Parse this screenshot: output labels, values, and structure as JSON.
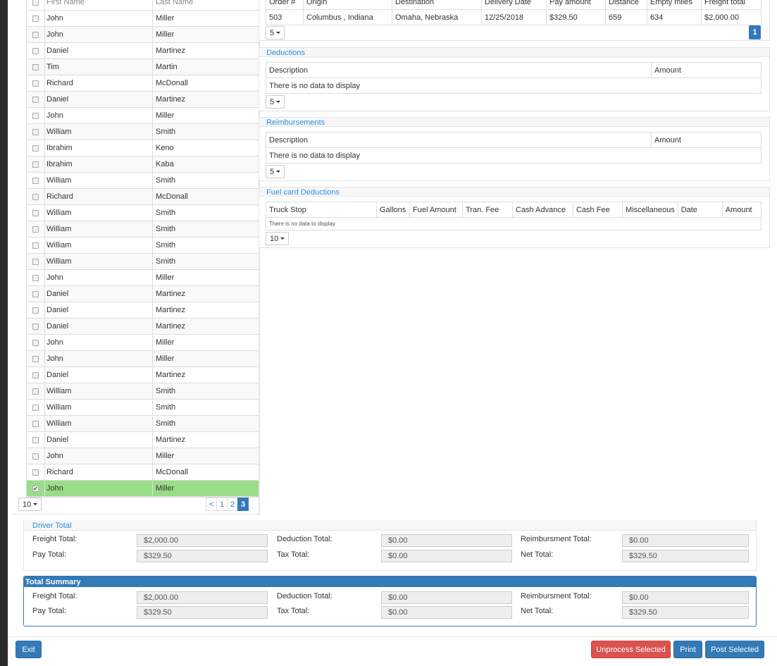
{
  "drivers": {
    "columns": [
      "First Name",
      "Last Name"
    ],
    "rows": [
      [
        "John",
        "Miller"
      ],
      [
        "John",
        "Miller"
      ],
      [
        "Daniel",
        "Martinez"
      ],
      [
        "Tim",
        "Martin"
      ],
      [
        "Richard",
        "McDonall"
      ],
      [
        "Daniel",
        "Martinez"
      ],
      [
        "John",
        "Miller"
      ],
      [
        "William",
        "Smith"
      ],
      [
        "Ibrahim",
        "Keno"
      ],
      [
        "Ibrahim",
        "Kaba"
      ],
      [
        "William",
        "Smith"
      ],
      [
        "Richard",
        "McDonall"
      ],
      [
        "William",
        "Smith"
      ],
      [
        "William",
        "Smith"
      ],
      [
        "William",
        "Smith"
      ],
      [
        "William",
        "Smith"
      ],
      [
        "John",
        "Miller"
      ],
      [
        "Daniel",
        "Martinez"
      ],
      [
        "Daniel",
        "Martinez"
      ],
      [
        "Daniel",
        "Martinez"
      ],
      [
        "John",
        "Miller"
      ],
      [
        "John",
        "Miller"
      ],
      [
        "Daniel",
        "Martinez"
      ],
      [
        "William",
        "Smith"
      ],
      [
        "William",
        "Smith"
      ],
      [
        "William",
        "Smith"
      ],
      [
        "Daniel",
        "Martinez"
      ],
      [
        "John",
        "Miller"
      ],
      [
        "Richard",
        "McDonall"
      ],
      [
        "John",
        "Miller"
      ]
    ],
    "selected_index": 29,
    "page_size": "10",
    "pager": [
      "<",
      "1",
      "2",
      "3"
    ],
    "active_page": "3"
  },
  "orders": {
    "columns": [
      "Order #",
      "Origin",
      "Destination",
      "Delivery Date",
      "Pay amount",
      "Distance",
      "Empty miles",
      "Freight total"
    ],
    "row": [
      "503",
      "Columbus , Indiana",
      "Omaha, Nebraska",
      "12/25/2018",
      "$329.50",
      "659",
      "634",
      "$2,000.00"
    ],
    "page_size": "5",
    "page": "1"
  },
  "deductions": {
    "title": "Deductions",
    "columns": [
      "Description",
      "Amount"
    ],
    "empty": "There is no data to display",
    "page_size": "5"
  },
  "reimbursements": {
    "title": "Reimbursements",
    "columns": [
      "Description",
      "Amount"
    ],
    "empty": "There is no data to display",
    "page_size": "5"
  },
  "fuel": {
    "title": "Fuel card Deductions",
    "columns": [
      "Truck Stop",
      "Gallons",
      "Fuel Amount",
      "Tran. Fee",
      "Cash Advance",
      "Cash Fee",
      "Miscellaneous",
      "Date",
      "Amount"
    ],
    "empty": "There is no data to display",
    "page_size": "10"
  },
  "driver_total": {
    "title": "Driver Total",
    "freight_label": "Freight Total:",
    "freight": "$2,000.00",
    "pay_label": "Pay Total:",
    "pay": "$329.50",
    "deduction_label": "Deduction Total:",
    "deduction": "$0.00",
    "tax_label": "Tax Total:",
    "tax": "$0.00",
    "reimb_label": "Reimbursment Total:",
    "reimb": "$0.00",
    "net_label": "Net Total:",
    "net": "$329.50"
  },
  "total_summary": {
    "title": "Total Summary",
    "freight_label": "Freight Total:",
    "freight": "$2,000.00",
    "pay_label": "Pay Total:",
    "pay": "$329.50",
    "deduction_label": "Deduction Total:",
    "deduction": "$0.00",
    "tax_label": "Tax Total:",
    "tax": "$0.00",
    "reimb_label": "Reimbursment Total:",
    "reimb": "$0.00",
    "net_label": "Net Total:",
    "net": "$329.50"
  },
  "footer": {
    "exit": "Exit",
    "unprocess": "Unprocess Selected",
    "print": "Print",
    "post": "Post Selected"
  },
  "colors": {
    "primary": "#337ab7",
    "danger": "#d9534f",
    "selected_row": "#99dd88",
    "section_title": "#2b8ee0"
  }
}
